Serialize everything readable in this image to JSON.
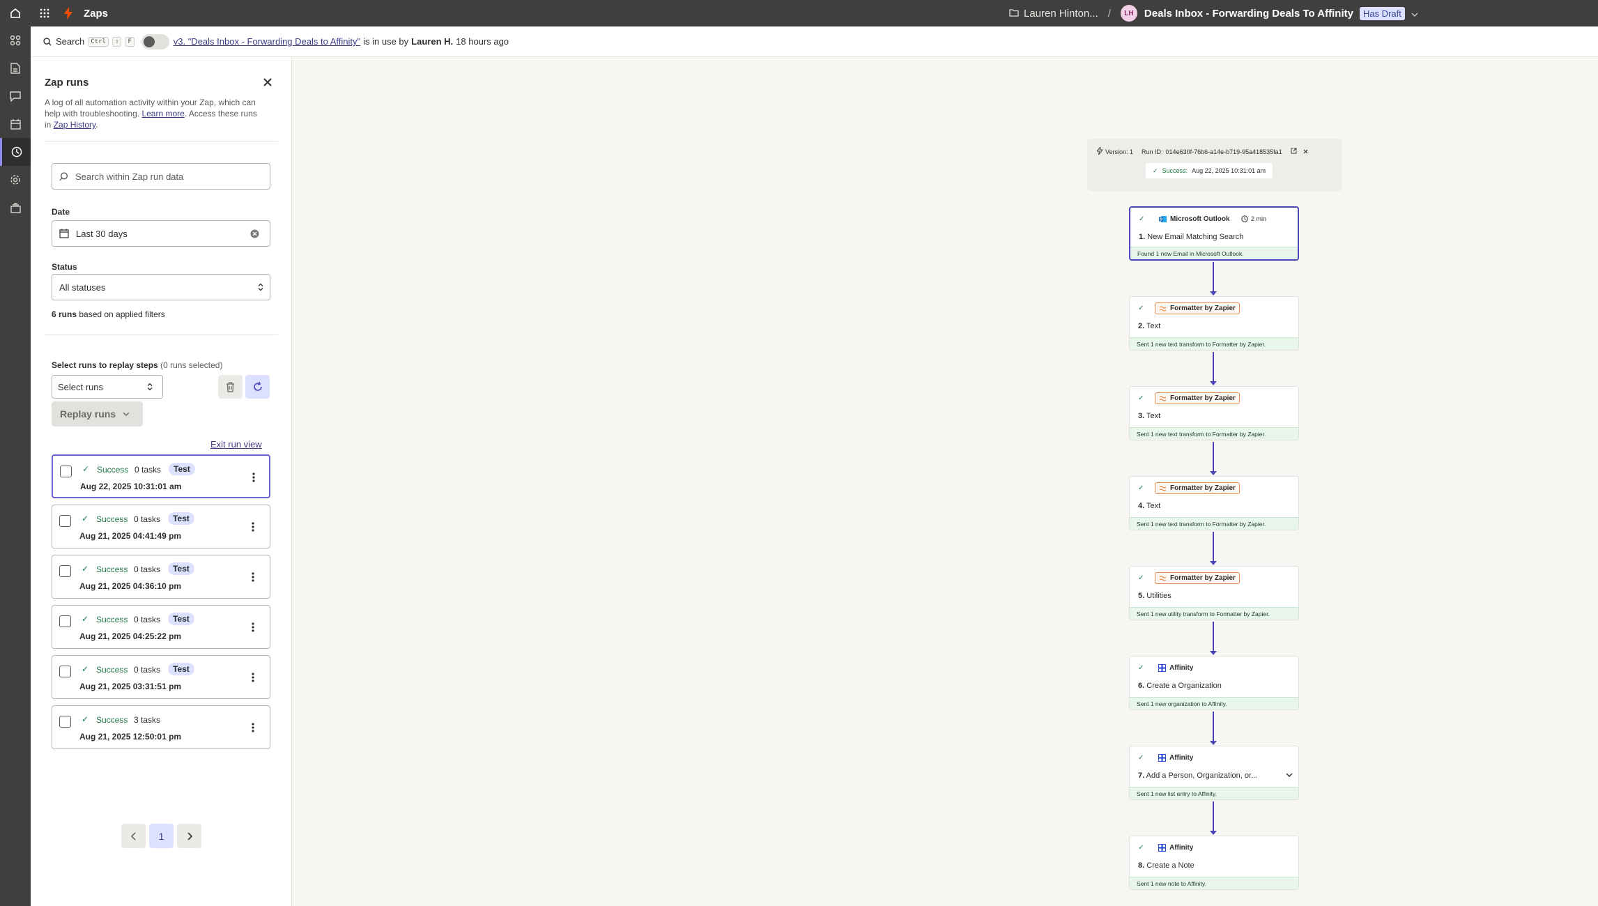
{
  "topbar": {
    "app": "Zaps",
    "owner": "Lauren Hinton...",
    "slash": "/",
    "avatar": "LH",
    "zap_name": "Deals Inbox - Forwarding Deals To Affinity",
    "draft_badge": "Has Draft"
  },
  "subbar": {
    "search": "Search",
    "kbd": [
      "Ctrl",
      "⇧",
      "F"
    ],
    "version_link": "v3. \"Deals Inbox - Forwarding Deals to Affinity\"",
    "in_use": "is in use by",
    "user": "Lauren H.",
    "ago": "18 hours ago"
  },
  "panel": {
    "title": "Zap runs",
    "desc_pre": "A log of all automation activity within your Zap, which can help with troubleshooting. ",
    "learn_more": "Learn more",
    "desc_mid": ". Access these runs in ",
    "zap_history": "Zap History",
    "desc_end": ".",
    "search_placeholder": "Search within Zap run data",
    "date_label": "Date",
    "date_value": "Last 30 days",
    "status_label": "Status",
    "status_value": "All statuses",
    "runs_count": "6 runs",
    "runs_suffix": " based on applied filters",
    "select_title": "Select runs to replay steps",
    "select_sub": " (0 runs selected)",
    "select_runs": "Select runs",
    "replay_runs": "Replay runs",
    "exit_run_view": "Exit run view",
    "page": "1"
  },
  "runs": [
    {
      "status": "Success",
      "tasks": "0 tasks",
      "tag": "Test",
      "date": "Aug 22, 2025 10:31:01 am"
    },
    {
      "status": "Success",
      "tasks": "0 tasks",
      "tag": "Test",
      "date": "Aug 21, 2025 04:41:49 pm"
    },
    {
      "status": "Success",
      "tasks": "0 tasks",
      "tag": "Test",
      "date": "Aug 21, 2025 04:36:10 pm"
    },
    {
      "status": "Success",
      "tasks": "0 tasks",
      "tag": "Test",
      "date": "Aug 21, 2025 04:25:22 pm"
    },
    {
      "status": "Success",
      "tasks": "0 tasks",
      "tag": "Test",
      "date": "Aug 21, 2025 03:31:51 pm"
    },
    {
      "status": "Success",
      "tasks": "3 tasks",
      "tag": "",
      "date": "Aug 21, 2025 12:50:01 pm"
    }
  ],
  "run_info": {
    "version": "Version: 1",
    "run_id_label": "Run ID:",
    "run_id": "014e630f-76b6-a14e-b719-95a418535fa1",
    "status": "Success:",
    "time": "Aug 22, 2025 10:31:01 am"
  },
  "steps": [
    {
      "app": "Microsoft Outlook",
      "num": "1.",
      "title": "New Email Matching Search",
      "footer": "Found 1 new Email in Microsoft Outlook.",
      "time": "2 min"
    },
    {
      "app": "Formatter by Zapier",
      "num": "2.",
      "title": "Text",
      "footer": "Sent 1 new text transform to Formatter by Zapier."
    },
    {
      "app": "Formatter by Zapier",
      "num": "3.",
      "title": "Text",
      "footer": "Sent 1 new text transform to Formatter by Zapier."
    },
    {
      "app": "Formatter by Zapier",
      "num": "4.",
      "title": "Text",
      "footer": "Sent 1 new text transform to Formatter by Zapier."
    },
    {
      "app": "Formatter by Zapier",
      "num": "5.",
      "title": "Utilities",
      "footer": "Sent 1 new utility transform to Formatter by Zapier."
    },
    {
      "app": "Affinity",
      "num": "6.",
      "title": "Create a Organization",
      "footer": "Sent 1 new organization to Affinity."
    },
    {
      "app": "Affinity",
      "num": "7.",
      "title": "Add a Person, Organization, or...",
      "footer": "Sent 1 new list entry to Affinity."
    },
    {
      "app": "Affinity",
      "num": "8.",
      "title": "Create a Note",
      "footer": "Sent 1 new note to Affinity."
    }
  ],
  "colors": {
    "accent": "#4b46b8",
    "topbar": "#403f3e",
    "success": "#1f7a45",
    "formatter": "#e58a4b"
  }
}
